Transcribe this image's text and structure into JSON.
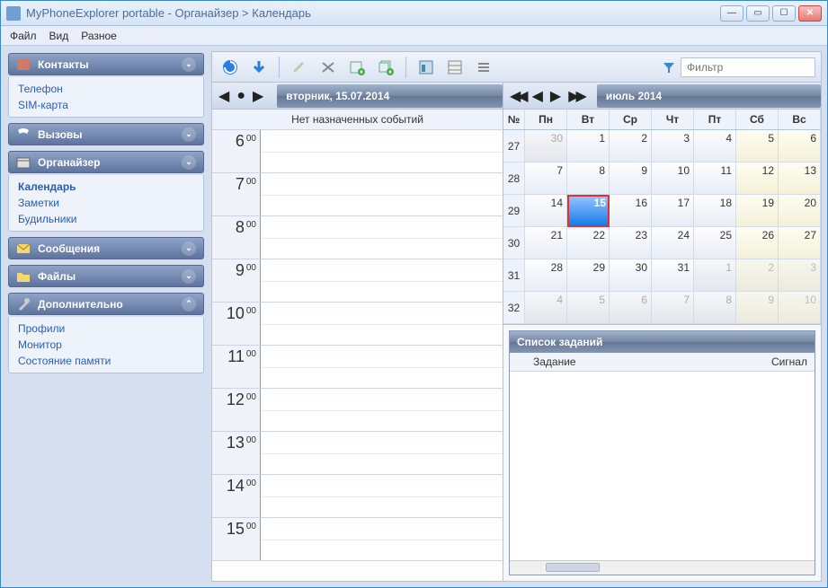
{
  "window": {
    "title": "MyPhoneExplorer portable -  Органайзер > Календарь"
  },
  "menu": {
    "file": "Файл",
    "view": "Вид",
    "other": "Разное"
  },
  "sidebar": {
    "contacts": {
      "label": "Контакты",
      "items": [
        "Телефон",
        "SIM-карта"
      ]
    },
    "calls": {
      "label": "Вызовы"
    },
    "organizer": {
      "label": "Органайзер",
      "items": [
        "Календарь",
        "Заметки",
        "Будильники"
      ],
      "active": 0
    },
    "messages": {
      "label": "Сообщения"
    },
    "files": {
      "label": "Файлы"
    },
    "extra": {
      "label": "Дополнительно",
      "items": [
        "Профили",
        "Монитор",
        "Состояние памяти"
      ]
    }
  },
  "toolbar": {
    "filter_placeholder": "Фильтр"
  },
  "day": {
    "date_label": "вторник, 15.07.2014",
    "no_events": "Нет назначенных событий",
    "hours": [
      "6",
      "7",
      "8",
      "9",
      "10",
      "11",
      "12",
      "13",
      "14",
      "15"
    ],
    "minutes": "00"
  },
  "month": {
    "title": "июль 2014",
    "wk_label": "№",
    "weekdays": [
      "Пн",
      "Вт",
      "Ср",
      "Чт",
      "Пт",
      "Сб",
      "Вс"
    ],
    "weeks": [
      {
        "num": "27",
        "days": [
          {
            "n": "30",
            "o": true
          },
          {
            "n": "1"
          },
          {
            "n": "2"
          },
          {
            "n": "3"
          },
          {
            "n": "4"
          },
          {
            "n": "5",
            "w": true
          },
          {
            "n": "6",
            "w": true
          }
        ]
      },
      {
        "num": "28",
        "days": [
          {
            "n": "7"
          },
          {
            "n": "8"
          },
          {
            "n": "9"
          },
          {
            "n": "10"
          },
          {
            "n": "11"
          },
          {
            "n": "12",
            "w": true
          },
          {
            "n": "13",
            "w": true
          }
        ]
      },
      {
        "num": "29",
        "days": [
          {
            "n": "14"
          },
          {
            "n": "15",
            "t": true
          },
          {
            "n": "16"
          },
          {
            "n": "17"
          },
          {
            "n": "18"
          },
          {
            "n": "19",
            "w": true
          },
          {
            "n": "20",
            "w": true
          }
        ]
      },
      {
        "num": "30",
        "days": [
          {
            "n": "21"
          },
          {
            "n": "22"
          },
          {
            "n": "23"
          },
          {
            "n": "24"
          },
          {
            "n": "25"
          },
          {
            "n": "26",
            "w": true
          },
          {
            "n": "27",
            "w": true
          }
        ]
      },
      {
        "num": "31",
        "days": [
          {
            "n": "28"
          },
          {
            "n": "29"
          },
          {
            "n": "30"
          },
          {
            "n": "31"
          },
          {
            "n": "1",
            "o": true
          },
          {
            "n": "2",
            "o": true,
            "w": true
          },
          {
            "n": "3",
            "o": true,
            "w": true
          }
        ]
      },
      {
        "num": "32",
        "days": [
          {
            "n": "4",
            "o": true
          },
          {
            "n": "5",
            "o": true
          },
          {
            "n": "6",
            "o": true
          },
          {
            "n": "7",
            "o": true
          },
          {
            "n": "8",
            "o": true
          },
          {
            "n": "9",
            "o": true,
            "w": true
          },
          {
            "n": "10",
            "o": true,
            "w": true
          }
        ]
      }
    ]
  },
  "tasks": {
    "title": "Список заданий",
    "col_task": "Задание",
    "col_alarm": "Сигнал"
  }
}
